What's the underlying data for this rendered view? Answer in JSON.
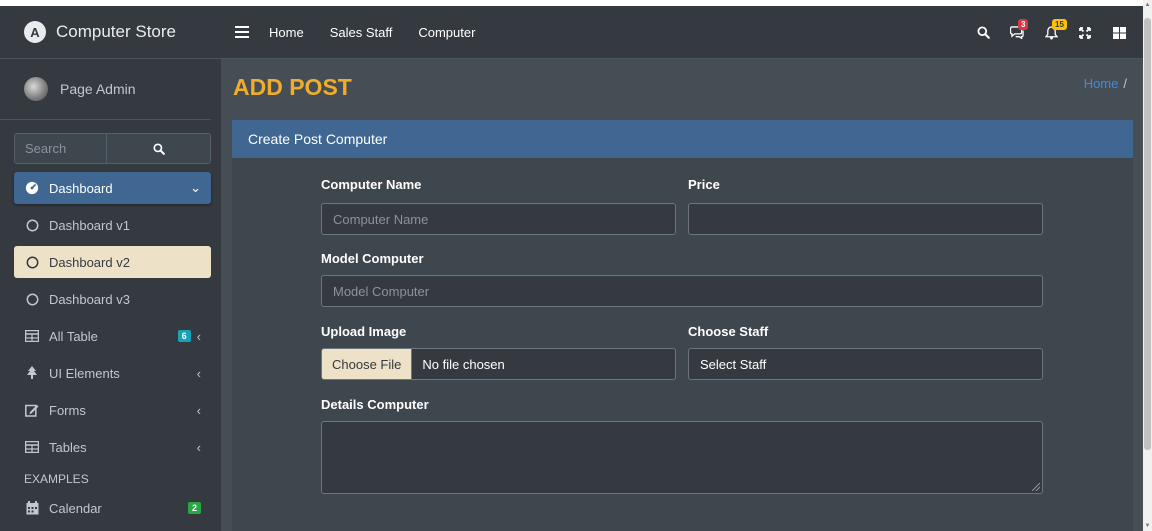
{
  "brand": {
    "name": "Computer Store",
    "logo_letter": "A"
  },
  "user": {
    "name": "Page Admin"
  },
  "sidebar_search": {
    "placeholder": "Search"
  },
  "sidebar": {
    "items": [
      {
        "label": "Dashboard",
        "icon": "tachometer-icon",
        "state": "active"
      },
      {
        "label": "Dashboard v1",
        "icon": "circle-icon"
      },
      {
        "label": "Dashboard v2",
        "icon": "circle-icon",
        "state": "selected"
      },
      {
        "label": "Dashboard v3",
        "icon": "circle-icon"
      },
      {
        "label": "All Table",
        "icon": "table-icon",
        "badge": "6"
      },
      {
        "label": "UI Elements",
        "icon": "tree-icon"
      },
      {
        "label": "Forms",
        "icon": "edit-icon"
      },
      {
        "label": "Tables",
        "icon": "table-icon"
      }
    ],
    "header": "EXAMPLES",
    "examples": [
      {
        "label": "Calendar",
        "icon": "calendar-icon",
        "badge": "2"
      }
    ]
  },
  "topnav": {
    "links": [
      "Home",
      "Sales Staff",
      "Computer"
    ],
    "messages_badge": "3",
    "notifications_badge": "15"
  },
  "page": {
    "title": "ADD POST",
    "breadcrumb_home": "Home",
    "breadcrumb_sep": "/"
  },
  "form": {
    "header": "Create Post Computer",
    "computer_name_label": "Computer Name",
    "computer_name_placeholder": "Computer Name",
    "price_label": "Price",
    "model_label": "Model Computer",
    "model_placeholder": "Model Computer",
    "upload_label": "Upload Image",
    "choose_file": "Choose File",
    "no_file": "No file chosen",
    "staff_label": "Choose Staff",
    "staff_selected": "Select Staff",
    "details_label": "Details Computer"
  },
  "colors": {
    "accent_blue": "#3f6791",
    "title_orange": "#f0ad2b",
    "sidebar_bg": "#343a40",
    "content_bg": "#454d55"
  }
}
